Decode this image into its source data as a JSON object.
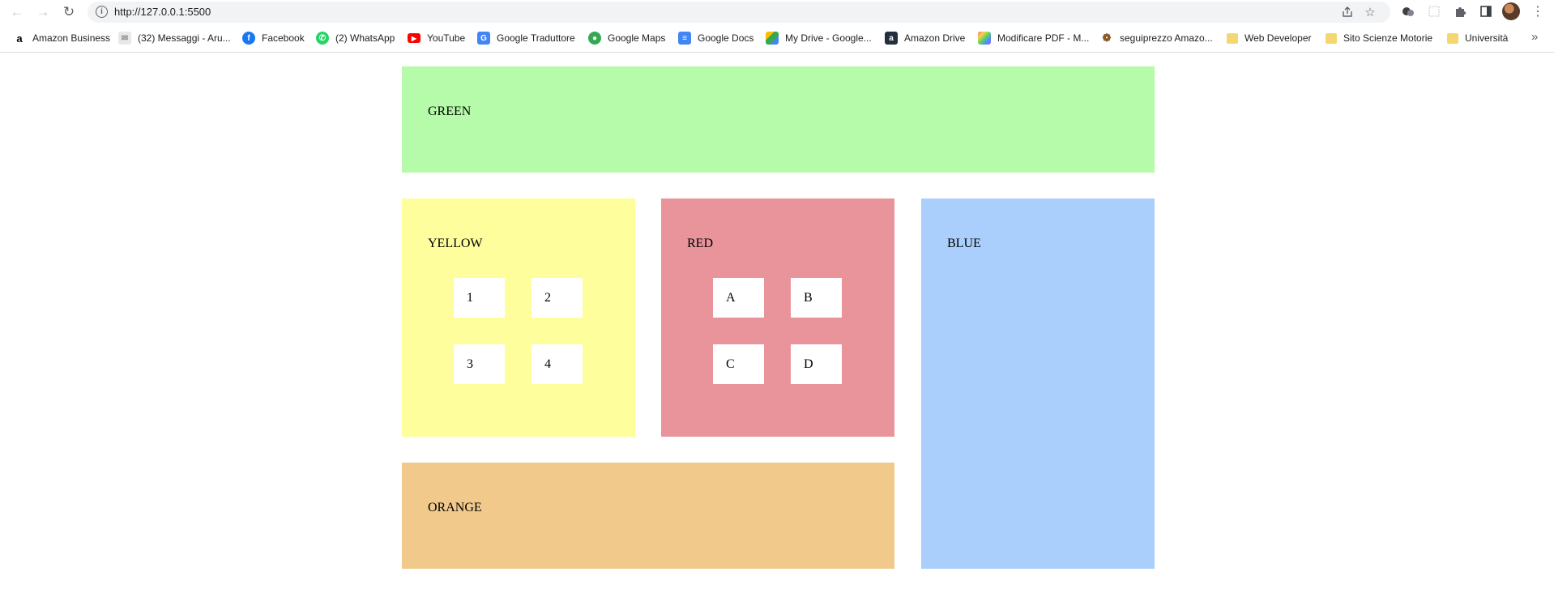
{
  "browser": {
    "url": "http://127.0.0.1:5500"
  },
  "bookmarks": [
    {
      "label": "Amazon Business",
      "icon": "amazon-icon"
    },
    {
      "label": "(32) Messaggi - Aru...",
      "icon": "aruba-mail-icon"
    },
    {
      "label": "Facebook",
      "icon": "facebook-icon"
    },
    {
      "label": "(2) WhatsApp",
      "icon": "whatsapp-icon"
    },
    {
      "label": "YouTube",
      "icon": "youtube-icon"
    },
    {
      "label": "Google Traduttore",
      "icon": "google-translate-icon"
    },
    {
      "label": "Google Maps",
      "icon": "google-maps-icon"
    },
    {
      "label": "Google Docs",
      "icon": "google-docs-icon"
    },
    {
      "label": "My Drive - Google...",
      "icon": "google-drive-icon"
    },
    {
      "label": "Amazon Drive",
      "icon": "amazon-drive-icon"
    },
    {
      "label": "Modificare PDF - M...",
      "icon": "pdf-editor-icon"
    },
    {
      "label": "seguiprezzo Amazo...",
      "icon": "camel-icon"
    },
    {
      "label": "Web Developer",
      "icon": "folder-icon"
    },
    {
      "label": "Sito Scienze Motorie",
      "icon": "folder-icon"
    },
    {
      "label": "Università",
      "icon": "folder-icon"
    }
  ],
  "page": {
    "green": {
      "label": "GREEN",
      "color": "#b5fba9"
    },
    "yellow": {
      "label": "YELLOW",
      "color": "#fefe9d",
      "tiles": [
        "1",
        "2",
        "3",
        "4"
      ]
    },
    "red": {
      "label": "RED",
      "color": "#e8949a",
      "tiles": [
        "A",
        "B",
        "C",
        "D"
      ]
    },
    "blue": {
      "label": "BLUE",
      "color": "#aacffc"
    },
    "orange": {
      "label": "ORANGE",
      "color": "#f0c98b"
    }
  }
}
